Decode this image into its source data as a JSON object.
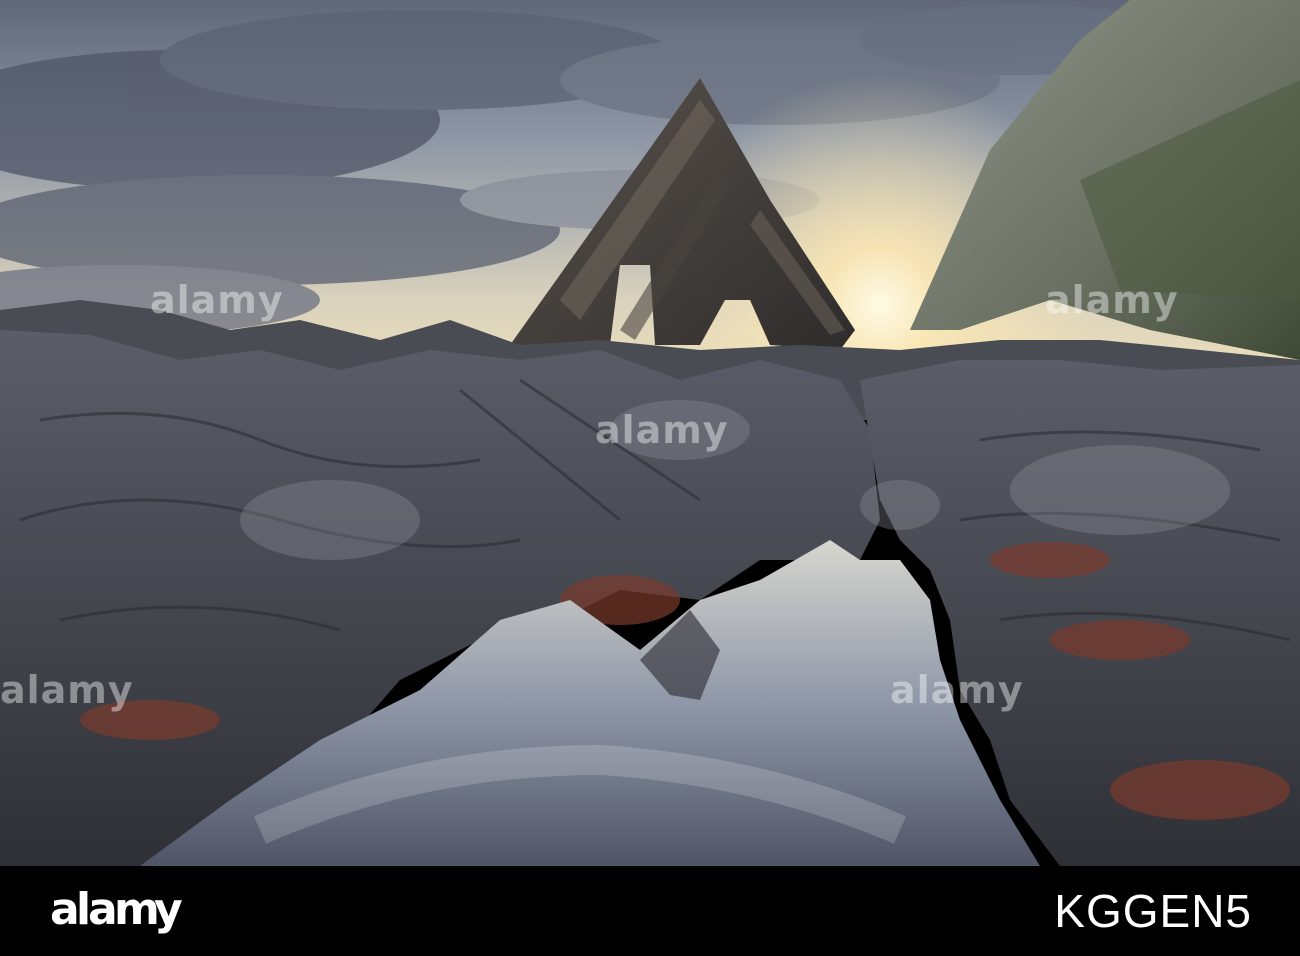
{
  "photo": {
    "subject": "Sea arch rock formation at sunrise with rock pool reflection",
    "watermark_text": "alamy",
    "palette": {
      "sky_top": "#6b7384",
      "sky_glow": "#f3dfb0",
      "sun": "#fff7dc",
      "rock_dark": "#3d3f46",
      "rock_mid": "#6a6d78",
      "cliff": "#7d847a",
      "seaweed": "#7a3a2c",
      "pool": "#8c93a3"
    }
  },
  "footer": {
    "brand": "alamy",
    "image_id": "KGGEN5",
    "background": "#000000",
    "text_color": "#ffffff"
  }
}
